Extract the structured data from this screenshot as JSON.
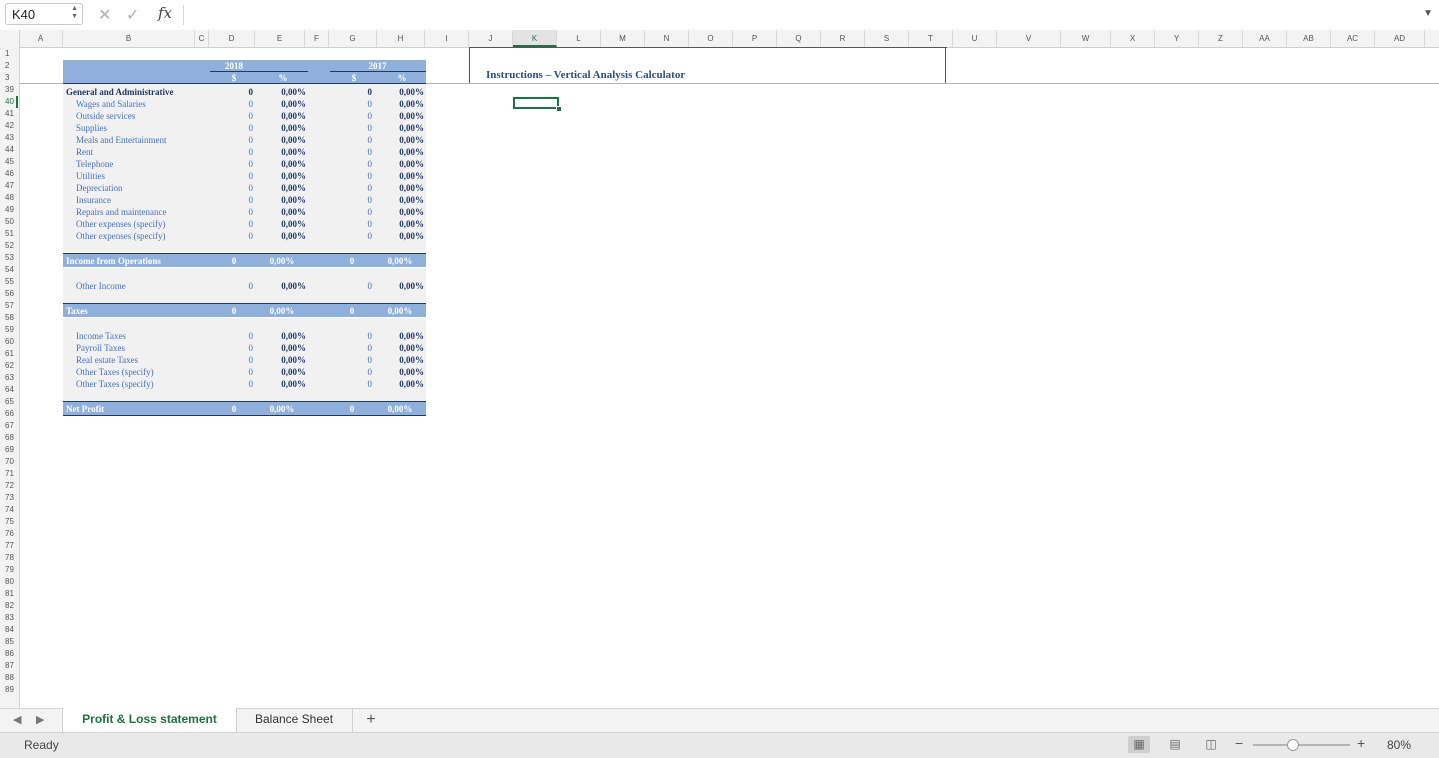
{
  "formula_bar": {
    "name_box": "K40",
    "cancel_icon": "✕",
    "enter_icon": "✓",
    "fx_label": "fx",
    "formula": ""
  },
  "columns": [
    "A",
    "B",
    "C",
    "D",
    "E",
    "F",
    "G",
    "H",
    "I",
    "J",
    "K",
    "L",
    "M",
    "N",
    "O",
    "P",
    "Q",
    "R",
    "S",
    "T",
    "U",
    "V",
    "W",
    "X",
    "Y",
    "Z",
    "AA",
    "AB",
    "AC",
    "AD"
  ],
  "selected_column": "K",
  "rows": [
    "1",
    "2",
    "3",
    "39",
    "40",
    "41",
    "42",
    "43",
    "44",
    "45",
    "46",
    "47",
    "48",
    "49",
    "50",
    "51",
    "52",
    "53",
    "54",
    "55",
    "56",
    "57",
    "58",
    "59",
    "60",
    "61",
    "62",
    "63",
    "64",
    "65",
    "66",
    "67",
    "68",
    "69",
    "70",
    "71",
    "72",
    "73",
    "74",
    "75",
    "76",
    "77",
    "78",
    "79",
    "80",
    "81",
    "82",
    "83",
    "84",
    "85",
    "86",
    "87",
    "88",
    "89"
  ],
  "selected_row": "40",
  "table": {
    "header": {
      "year1": "2018",
      "year2": "2017",
      "dollar1": "$",
      "pct1": "%",
      "dollar2": "$",
      "pct2": "%"
    },
    "ga": {
      "title": "General and Administrative",
      "d": "0",
      "e": "0,00%",
      "g": "0",
      "h": "0,00%",
      "items": [
        {
          "label": "Wages and Salaries",
          "d": "0",
          "e": "0,00%",
          "g": "0",
          "h": "0,00%"
        },
        {
          "label": "Outside services",
          "d": "0",
          "e": "0,00%",
          "g": "0",
          "h": "0,00%"
        },
        {
          "label": "Supplies",
          "d": "0",
          "e": "0,00%",
          "g": "0",
          "h": "0,00%"
        },
        {
          "label": "Meals and Entertainment",
          "d": "0",
          "e": "0,00%",
          "g": "0",
          "h": "0,00%"
        },
        {
          "label": "Rent",
          "d": "0",
          "e": "0,00%",
          "g": "0",
          "h": "0,00%"
        },
        {
          "label": "Telephone",
          "d": "0",
          "e": "0,00%",
          "g": "0",
          "h": "0,00%"
        },
        {
          "label": "Utilities",
          "d": "0",
          "e": "0,00%",
          "g": "0",
          "h": "0,00%"
        },
        {
          "label": "Depreciation",
          "d": "0",
          "e": "0,00%",
          "g": "0",
          "h": "0,00%"
        },
        {
          "label": "Insurance",
          "d": "0",
          "e": "0,00%",
          "g": "0",
          "h": "0,00%"
        },
        {
          "label": "Repairs and maintenance",
          "d": "0",
          "e": "0,00%",
          "g": "0",
          "h": "0,00%"
        },
        {
          "label": "Other expenses (specify)",
          "d": "0",
          "e": "0,00%",
          "g": "0",
          "h": "0,00%"
        },
        {
          "label": "Other expenses (specify)",
          "d": "0",
          "e": "0,00%",
          "g": "0",
          "h": "0,00%"
        }
      ]
    },
    "income_ops": {
      "label": "Income from Operations",
      "d": "0",
      "e": "0,00%",
      "g": "0",
      "h": "0,00%"
    },
    "other_income": {
      "label": "Other Income",
      "d": "0",
      "e": "0,00%",
      "g": "0",
      "h": "0,00%"
    },
    "taxes": {
      "label": "Taxes",
      "d": "0",
      "e": "0,00%",
      "g": "0",
      "h": "0,00%"
    },
    "tax_items": [
      {
        "label": "Income Taxes",
        "d": "0",
        "e": "0,00%",
        "g": "0",
        "h": "0,00%"
      },
      {
        "label": "Payroll Taxes",
        "d": "0",
        "e": "0,00%",
        "g": "0",
        "h": "0,00%"
      },
      {
        "label": "Real estate Taxes",
        "d": "0",
        "e": "0,00%",
        "g": "0",
        "h": "0,00%"
      },
      {
        "label": "Other Taxes (specify)",
        "d": "0",
        "e": "0,00%",
        "g": "0",
        "h": "0,00%"
      },
      {
        "label": "Other Taxes (specify)",
        "d": "0",
        "e": "0,00%",
        "g": "0",
        "h": "0,00%"
      }
    ],
    "net_profit": {
      "label": "Net Profit",
      "d": "0",
      "e": "0,00%",
      "g": "0",
      "h": "0,00%"
    }
  },
  "instructions": {
    "title": "Instructions – Vertical Analysis Calculator"
  },
  "sheet_tabs": {
    "active": "Profit & Loss statement",
    "other": "Balance Sheet",
    "add": "+"
  },
  "status": {
    "ready": "Ready",
    "zoom": "80%",
    "zoom_fraction": 0.4
  }
}
